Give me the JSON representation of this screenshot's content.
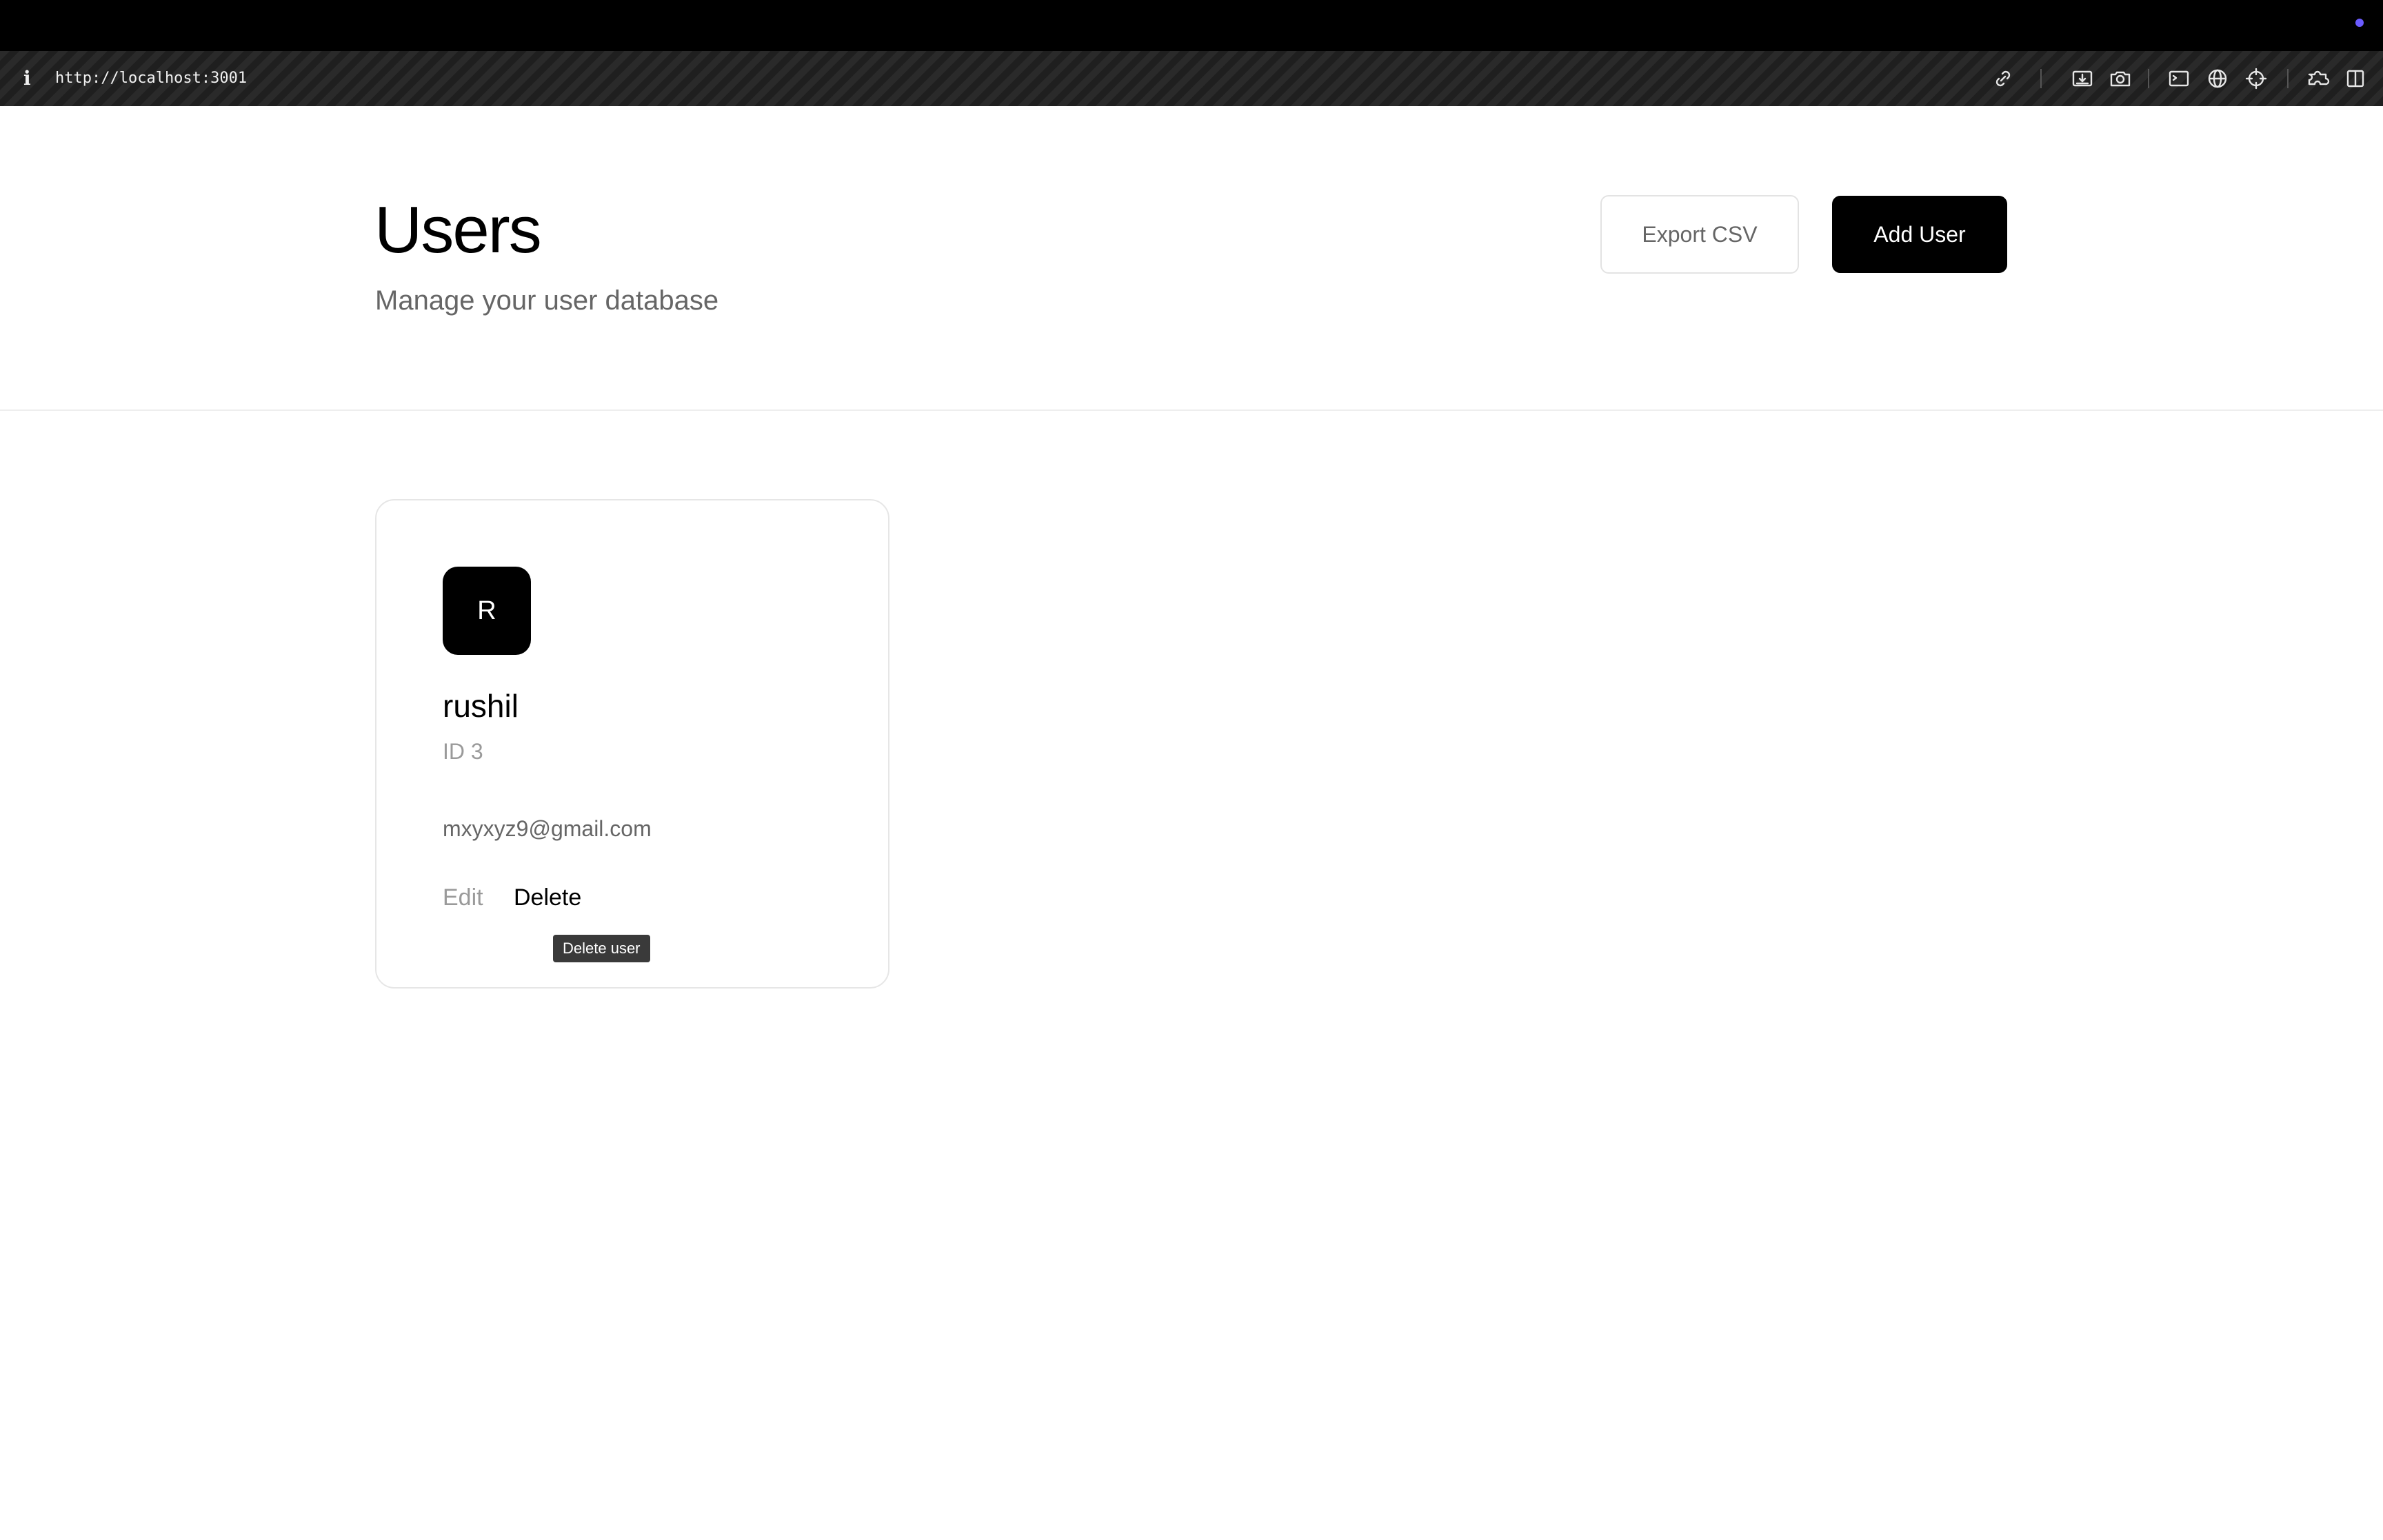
{
  "browser": {
    "url": "http://localhost:3001",
    "info_glyph": "i"
  },
  "header": {
    "title": "Users",
    "subtitle": "Manage your user database",
    "export_label": "Export CSV",
    "add_label": "Add User"
  },
  "users": [
    {
      "avatar_initial": "R",
      "name": "rushil",
      "id_label": "ID 3",
      "email": "mxyxyz9@gmail.com",
      "edit_label": "Edit",
      "delete_label": "Delete"
    }
  ],
  "tooltip": {
    "text": "Delete user"
  },
  "colors": {
    "accent": "#000000",
    "status_dot": "#6b5bff",
    "muted_text": "#666666",
    "faint_text": "#9a9a9a"
  },
  "icons": {
    "toolbar": [
      "link-icon",
      "download-icon",
      "camera-icon",
      "terminal-icon",
      "globe-icon",
      "crosshair-icon",
      "extensions-icon",
      "split-view-icon"
    ]
  }
}
